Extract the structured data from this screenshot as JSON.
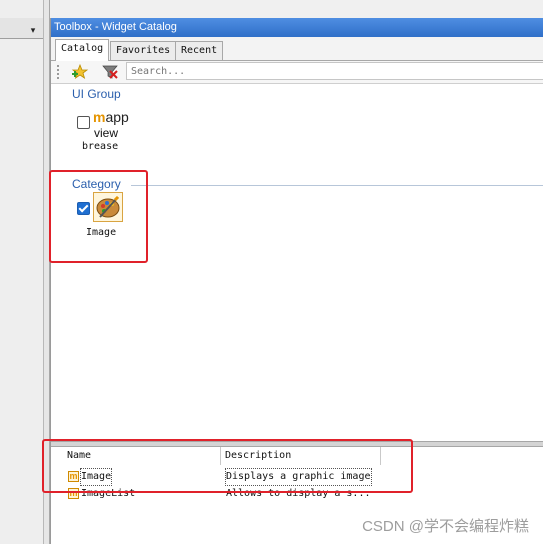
{
  "left_panel": {
    "dropdown_glyph": "▾"
  },
  "window": {
    "title": "Toolbox - Widget Catalog"
  },
  "tabs": [
    {
      "label": "Catalog",
      "active": true
    },
    {
      "label": "Favorites",
      "active": false
    },
    {
      "label": "Recent",
      "active": false
    }
  ],
  "toolbar": {
    "add_favorite_icon": "star-plus-icon",
    "filter_icon": "filter-clear-icon",
    "search_placeholder": "Search..."
  },
  "groups": {
    "ui_group": {
      "header": "UI Group",
      "item": {
        "logo_m": "m",
        "logo_rest": "app",
        "line2": "view",
        "line3": "brease",
        "checked": false
      }
    },
    "category": {
      "header": "Category",
      "item": {
        "label": "Image",
        "checked": true,
        "icon": "image-palette-icon"
      }
    }
  },
  "list": {
    "columns": [
      "Name",
      "Description"
    ],
    "rows": [
      {
        "name": "Image",
        "description": "Displays a graphic image",
        "selected": true
      },
      {
        "name": "ImageList",
        "description": "Allows to display a s...",
        "selected": false
      }
    ]
  },
  "watermark": "CSDN @学不会编程炸糕",
  "colors": {
    "accent": "#2b5fad",
    "highlight": "#e0212a",
    "brand": "#e59400"
  }
}
